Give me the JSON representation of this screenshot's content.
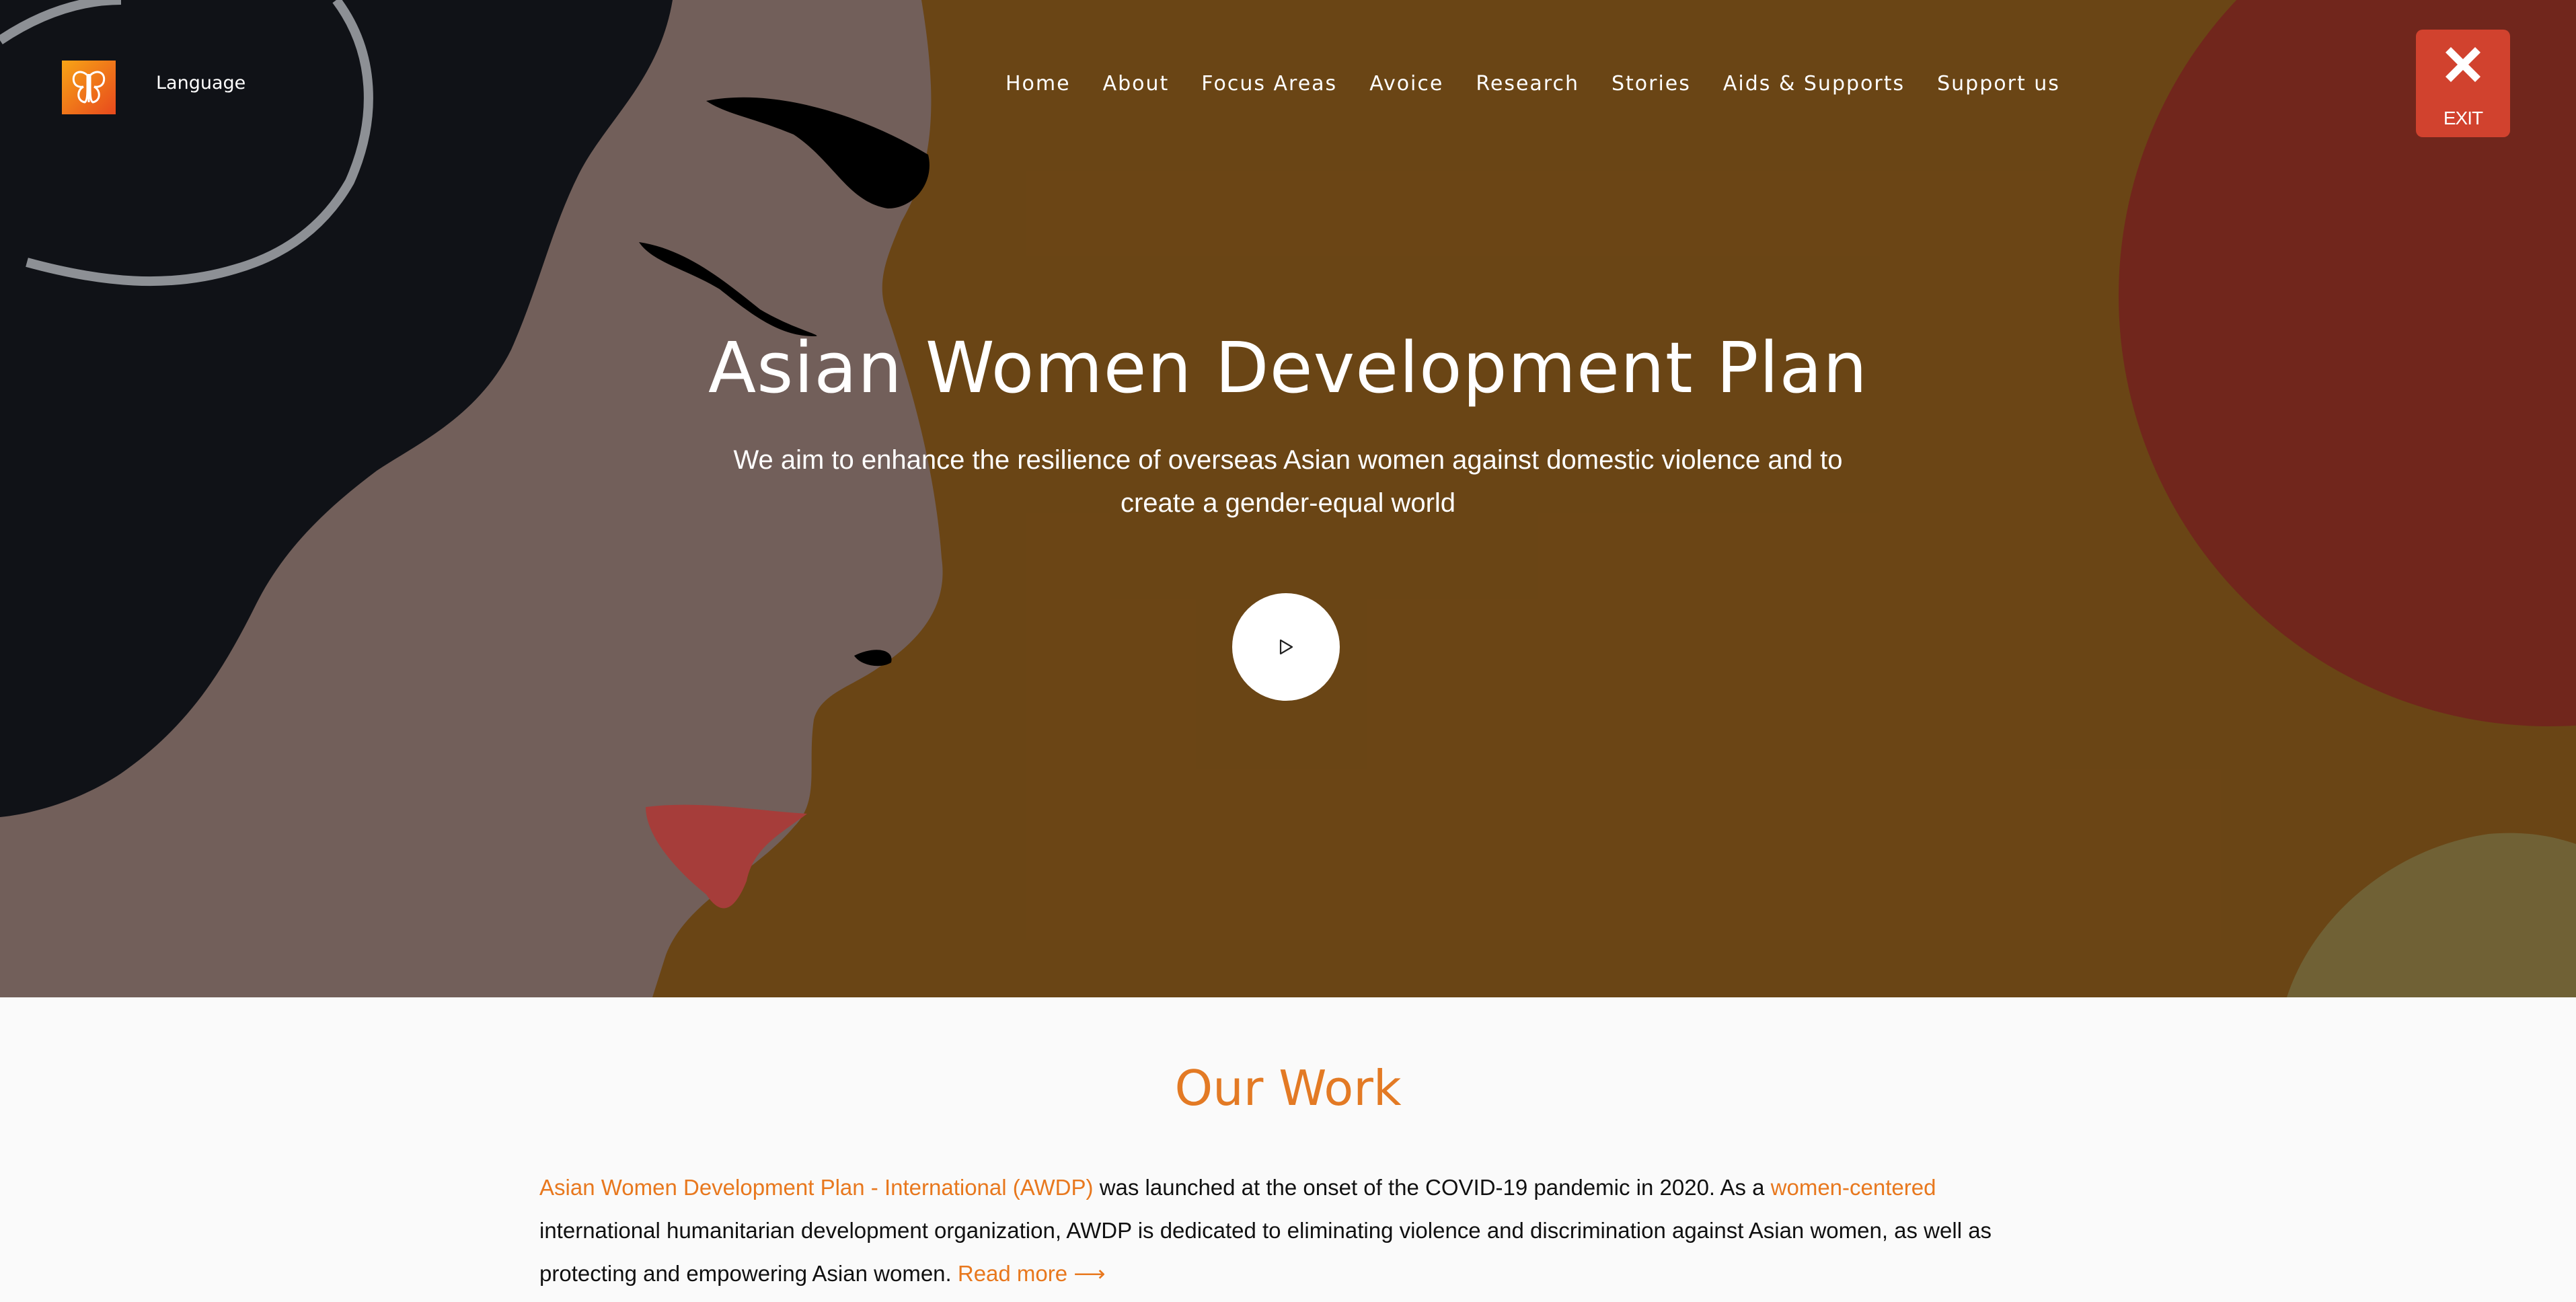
{
  "header": {
    "logo_icon": "butterfly-icon",
    "language_label": "Language",
    "nav": [
      "Home",
      "About",
      "Focus Areas",
      "Avoice",
      "Research",
      "Stories",
      "Aids & Supports",
      "Support us"
    ],
    "exit_label": "EXIT",
    "exit_icon": "close-icon"
  },
  "hero": {
    "title": "Asian Women Development Plan",
    "subtitle": "We aim to enhance the resilience of overseas Asian women against domestic violence and to create a gender-equal world",
    "play_icon": "play-icon"
  },
  "our_work": {
    "title": "Our Work",
    "org_name": "Asian Women Development Plan - International (AWDP)",
    "text_1": " was launched at the onset of the COVID-19 pandemic in 2020. As a ",
    "highlight": "women-centered",
    "text_2": " international humanitarian development organization, AWDP is dedicated to eliminating violence and discrimination against Asian women, as well as protecting and empowering Asian women. ",
    "read_more": "Read more ⟶"
  },
  "colors": {
    "accent": "#e8781e",
    "exit_button": "#d1422e",
    "hero_ochre": "#754b16"
  }
}
